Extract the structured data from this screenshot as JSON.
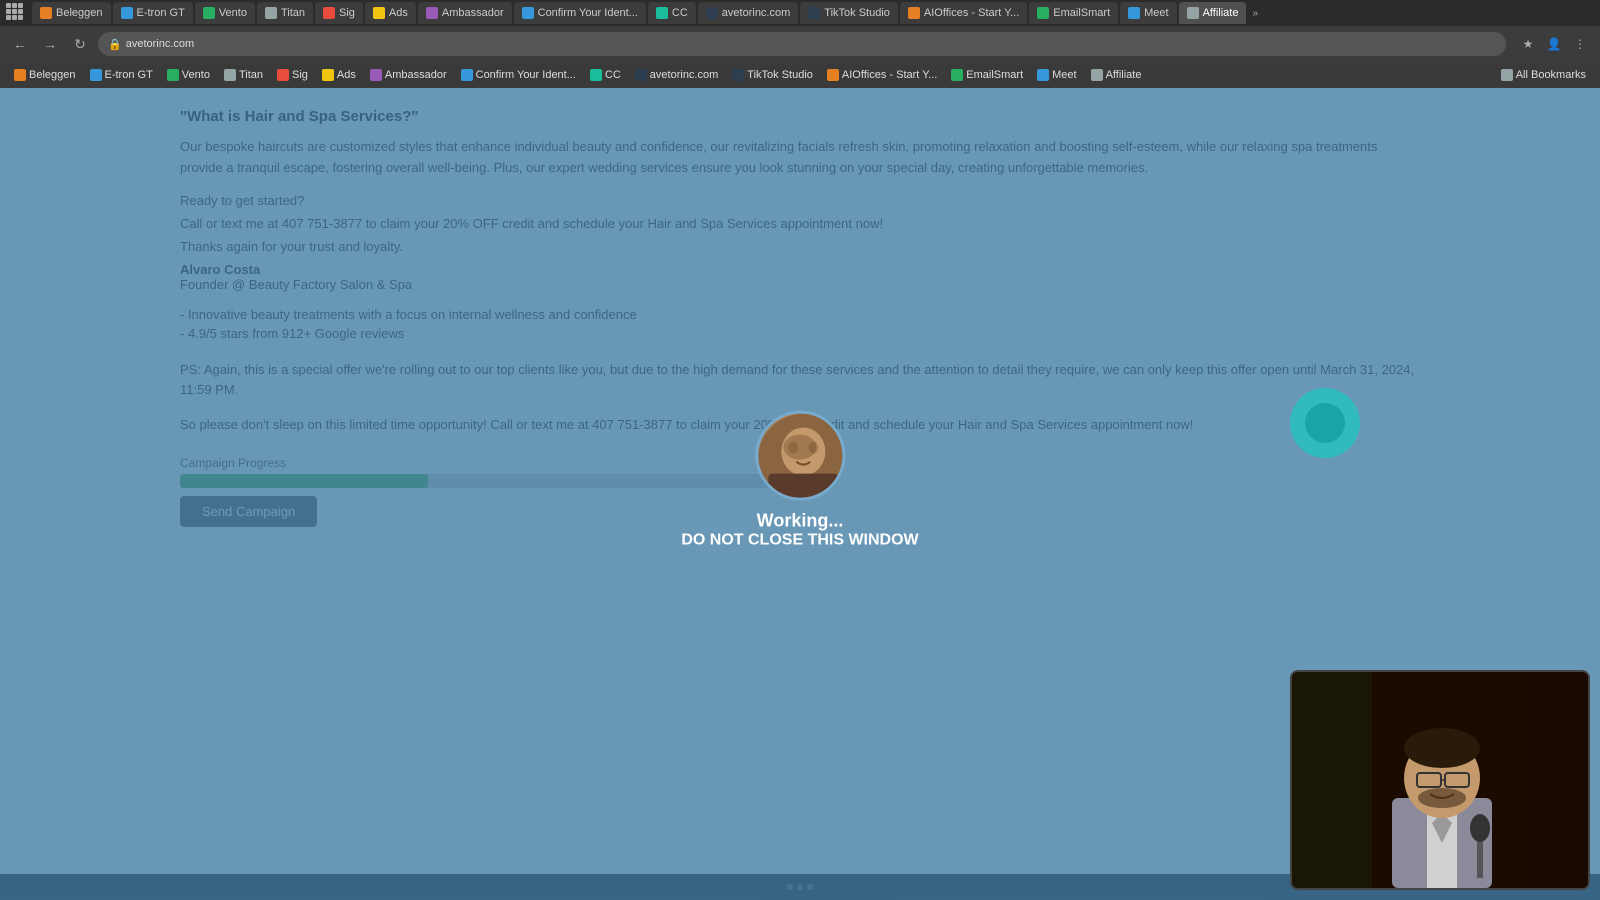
{
  "browser": {
    "tabs": [
      {
        "label": "Beleggen",
        "favicon_color": "fv-orange",
        "active": false
      },
      {
        "label": "E-tron GT",
        "favicon_color": "fv-blue",
        "active": false
      },
      {
        "label": "Vento",
        "favicon_color": "fv-green",
        "active": false
      },
      {
        "label": "Titan",
        "favicon_color": "fv-gray",
        "active": false
      },
      {
        "label": "Sig",
        "favicon_color": "fv-red",
        "active": false
      },
      {
        "label": "Ads",
        "favicon_color": "fv-yellow",
        "active": false
      },
      {
        "label": "Ambassador",
        "favicon_color": "fv-purple",
        "active": false
      },
      {
        "label": "Confirm Your Ident...",
        "favicon_color": "fv-blue",
        "active": false
      },
      {
        "label": "CC",
        "favicon_color": "fv-teal",
        "active": false
      },
      {
        "label": "avetorinc.com",
        "favicon_color": "fv-dark",
        "active": false
      },
      {
        "label": "TikTok Studio",
        "favicon_color": "fv-dark",
        "active": false
      },
      {
        "label": "AIOffices - Start Y...",
        "favicon_color": "fv-orange",
        "active": false
      },
      {
        "label": "EmailSmart",
        "favicon_color": "fv-green",
        "active": false
      },
      {
        "label": "Meet",
        "favicon_color": "fv-blue",
        "active": false
      },
      {
        "label": "Affiliate",
        "favicon_color": "fv-gray",
        "active": true
      }
    ],
    "bookmarks": [
      {
        "label": "Beleggen",
        "favicon_color": "fv-orange"
      },
      {
        "label": "E-tron GT",
        "favicon_color": "fv-blue"
      },
      {
        "label": "Vento",
        "favicon_color": "fv-green"
      },
      {
        "label": "Titan",
        "favicon_color": "fv-gray"
      },
      {
        "label": "Sig",
        "favicon_color": "fv-red"
      },
      {
        "label": "Ads",
        "favicon_color": "fv-yellow"
      },
      {
        "label": "Ambassador",
        "favicon_color": "fv-purple"
      },
      {
        "label": "Confirm Your Ident...",
        "favicon_color": "fv-blue"
      },
      {
        "label": "CC",
        "favicon_color": "fv-teal"
      },
      {
        "label": "avetorinc.com",
        "favicon_color": "fv-dark"
      },
      {
        "label": "TikTok Studio",
        "favicon_color": "fv-dark"
      },
      {
        "label": "AIOffices - Start Y...",
        "favicon_color": "fv-orange"
      },
      {
        "label": "EmailSmart",
        "favicon_color": "fv-green"
      },
      {
        "label": "Meet",
        "favicon_color": "fv-blue"
      },
      {
        "label": "Affiliate",
        "favicon_color": "fv-gray"
      },
      {
        "label": "All Bookmarks",
        "favicon_color": "fv-gray"
      }
    ]
  },
  "page": {
    "heading": "\"What is Hair and Spa Services?\"",
    "body1": "Our bespoke haircuts are customized styles that enhance individual beauty and confidence, our revitalizing facials refresh skin, promoting relaxation and boosting self-esteem, while our relaxing spa treatments provide a tranquil escape, fostering overall well-being. Plus, our expert wedding services ensure you look stunning on your special day, creating unforgettable memories.",
    "ready": "Ready to get started?",
    "cta": "Call or text me at 407 751-3877 to claim your 20% OFF credit and schedule your Hair and Spa Services appointment now!",
    "thanks": "Thanks again for your trust and loyalty.",
    "name": "Alvaro Costa",
    "title": "Founder @ Beauty Factory Salon & Spa",
    "bullet1": "- Innovative beauty treatments with a focus on internal wellness and confidence",
    "bullet2": "- 4.9/5 stars from 912+ Google reviews",
    "ps": "PS: Again, this is a special offer we're rolling out to our top clients like you, but due to the high demand for these services and the attention to detail they require, we can only keep this offer open until March 31, 2024, 11:59 PM.",
    "cta2": "So please don't sleep on this limited time opportunity! Call or text me at 407 751-3877 to claim your 20% OFF credit and schedule your Hair and Spa Services appointment now!",
    "progress_label": "Campaign Progress",
    "send_btn": "Send Campaign",
    "progress_percent": 40
  },
  "modal": {
    "working_label": "Working...",
    "do_not_close": "DO NOT CLOSE THIS WINDOW"
  }
}
